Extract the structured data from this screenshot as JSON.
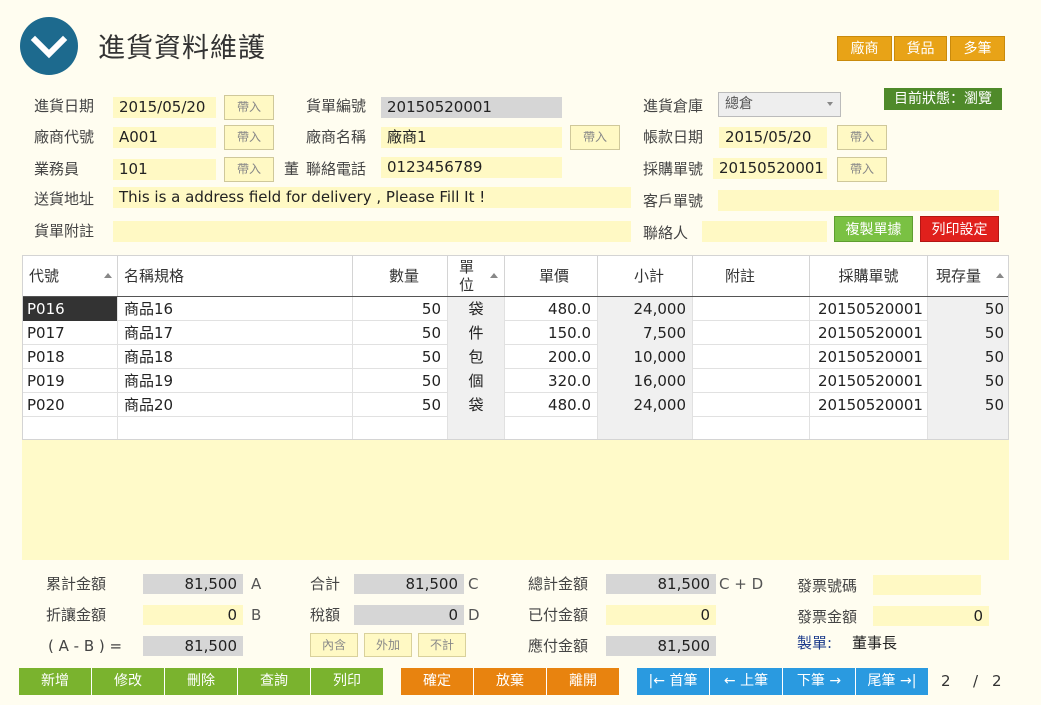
{
  "app": {
    "title": "進貨資料維護"
  },
  "header_buttons": [
    "廠商",
    "貨品",
    "多筆"
  ],
  "status": {
    "label": "目前狀態：",
    "value": "瀏覽"
  },
  "form": {
    "import_label": "帶入",
    "purchase_date": {
      "label": "進貨日期",
      "value": "2015/05/20"
    },
    "doc_no": {
      "label": "貨單編號",
      "value": "20150520001"
    },
    "warehouse": {
      "label": "進貨倉庫",
      "value": "總倉"
    },
    "vendor_code": {
      "label": "廠商代號",
      "value": "A001"
    },
    "vendor_name": {
      "label": "廠商名稱",
      "value": "廠商1"
    },
    "account_date": {
      "label": "帳款日期",
      "value": "2015/05/20"
    },
    "salesman": {
      "label": "業務員",
      "value": "101",
      "truncated": "董"
    },
    "phone": {
      "label": "聯絡電話",
      "value": "0123456789"
    },
    "po_no": {
      "label": "採購單號",
      "value": "20150520001"
    },
    "address": {
      "label": "送貨地址",
      "value": "This is a address field for delivery , Please Fill It !"
    },
    "customer_no": {
      "label": "客戶單號",
      "value": ""
    },
    "note": {
      "label": "貨單附註",
      "value": ""
    },
    "contact": {
      "label": "聯絡人",
      "value": ""
    }
  },
  "actions": {
    "copy": "複製單據",
    "print_settings": "列印設定"
  },
  "grid": {
    "columns": [
      "代號",
      "名稱規格",
      "數量",
      "單位",
      "單價",
      "小計",
      "附註",
      "採購單號",
      "現存量"
    ],
    "unit_header_top": "單",
    "unit_header_bottom": "位",
    "rows": [
      [
        "P016",
        "商品16",
        "50",
        "袋",
        "480.0",
        "24,000",
        "",
        "20150520001",
        "50"
      ],
      [
        "P017",
        "商品17",
        "50",
        "件",
        "150.0",
        "7,500",
        "",
        "20150520001",
        "50"
      ],
      [
        "P018",
        "商品18",
        "50",
        "包",
        "200.0",
        "10,000",
        "",
        "20150520001",
        "50"
      ],
      [
        "P019",
        "商品19",
        "50",
        "個",
        "320.0",
        "16,000",
        "",
        "20150520001",
        "50"
      ],
      [
        "P020",
        "商品20",
        "50",
        "袋",
        "480.0",
        "24,000",
        "",
        "20150520001",
        "50"
      ],
      [
        "",
        "",
        "",
        "",
        "",
        "",
        "",
        "",
        ""
      ]
    ]
  },
  "summary": {
    "cumulative": {
      "label": "累計金額",
      "value": "81,500",
      "suffix": "A"
    },
    "discount": {
      "label": "折讓金額",
      "value": "0",
      "suffix": "B"
    },
    "ab": {
      "label": "( A - B ) =",
      "value": "81,500"
    },
    "subtotal": {
      "label": "合計",
      "value": "81,500",
      "suffix": "C"
    },
    "tax": {
      "label": "稅額",
      "value": "0",
      "suffix": "D"
    },
    "tax_buttons": [
      "內含",
      "外加",
      "不計"
    ],
    "total": {
      "label": "總計金額",
      "value": "81,500",
      "suffix": "C + D"
    },
    "paid": {
      "label": "已付金額",
      "value": "0"
    },
    "payable": {
      "label": "應付金額",
      "value": "81,500"
    },
    "invoice_no": {
      "label": "發票號碼",
      "value": ""
    },
    "invoice_amount": {
      "label": "發票金額",
      "value": "0"
    },
    "maker": {
      "label": "製單:",
      "value": "董事長"
    }
  },
  "bottom_buttons": {
    "crud": [
      "新增",
      "修改",
      "刪除",
      "查詢",
      "列印"
    ],
    "confirm": [
      "確定",
      "放棄",
      "離開"
    ],
    "nav": [
      "|← 首筆",
      "← 上筆",
      "下筆 →",
      "尾筆 →|"
    ]
  },
  "pager": {
    "current": "2",
    "separator": "/",
    "total": "2"
  }
}
